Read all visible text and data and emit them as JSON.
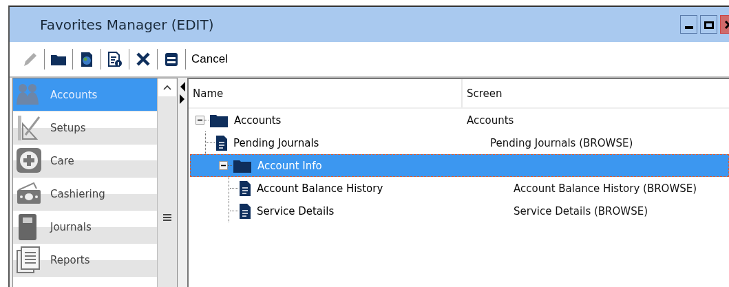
{
  "window": {
    "title": "Favorites Manager (EDIT)"
  },
  "toolbar": {
    "buttons": [
      {
        "kind": "pencil",
        "disabled": true
      },
      {
        "kind": "folder",
        "disabled": false
      },
      {
        "kind": "globe-doc",
        "disabled": false
      },
      {
        "kind": "doc-info",
        "disabled": false
      },
      {
        "kind": "delete",
        "disabled": false
      },
      {
        "kind": "save",
        "disabled": false
      },
      {
        "kind": "text",
        "label": "Cancel",
        "disabled": false
      }
    ]
  },
  "sidebar": {
    "items": [
      {
        "label": "Accounts",
        "kind": "people",
        "selected": true
      },
      {
        "label": "Setups",
        "kind": "ruler",
        "selected": false
      },
      {
        "label": "Care",
        "kind": "plus",
        "selected": false
      },
      {
        "label": "Cashiering",
        "kind": "cash",
        "selected": false
      },
      {
        "label": "Journals",
        "kind": "book",
        "selected": false
      },
      {
        "label": "Reports",
        "kind": "pages",
        "selected": false
      }
    ]
  },
  "tree": {
    "columns": [
      "Name",
      "Screen"
    ],
    "nodes": [
      {
        "kind": "folder",
        "name": "Accounts",
        "screen": "Accounts",
        "expanded": true,
        "selected": false,
        "children": [
          {
            "kind": "doc",
            "name": "Pending Journals",
            "screen": "Pending Journals (BROWSE)",
            "selected": false
          },
          {
            "kind": "folder",
            "name": "Account Info",
            "expanded": true,
            "selected": true,
            "children": [
              {
                "kind": "doc",
                "name": "Account Balance History",
                "screen": "Account Balance History (BROWSE)",
                "selected": false
              },
              {
                "kind": "doc",
                "name": "Service Details",
                "screen": "Service Details (BROWSE)",
                "selected": false
              }
            ]
          }
        ]
      }
    ]
  }
}
